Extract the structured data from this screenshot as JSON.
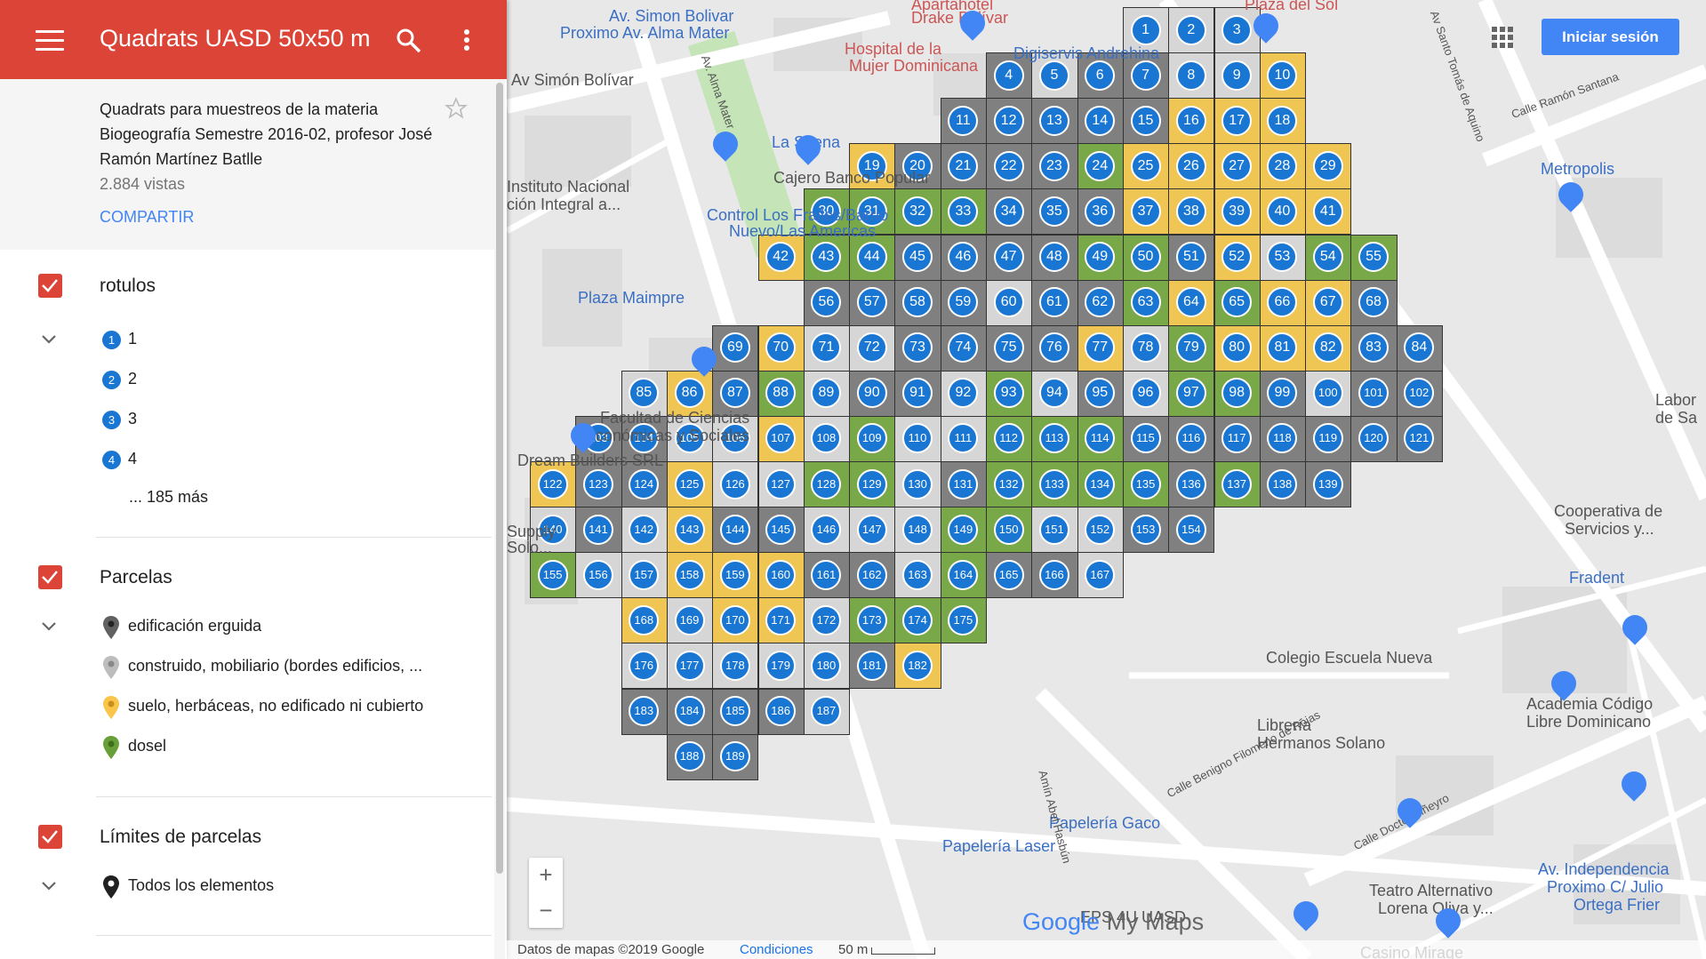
{
  "header": {
    "title": "Quadrats UASD 50x50 m",
    "menu_icon": "hamburger-icon",
    "search_icon": "search-icon",
    "more_icon": "more-vertical-icon"
  },
  "description": {
    "text": "Quadrats para muestreos de la materia Biogeografía Semestre 2016-02, profesor José Ramón Martínez Batlle",
    "views": "2.884 vistas",
    "share": "COMPARTIR"
  },
  "layers": [
    {
      "title": "rotulos",
      "items": [
        "1",
        "2",
        "3",
        "4"
      ],
      "more": "... 185 más"
    },
    {
      "title": "Parcelas",
      "items": [
        {
          "label": "edificación erguida",
          "color": "#616161"
        },
        {
          "label": "construido, mobiliario (bordes edificios, ...",
          "color": "#bdbdbd"
        },
        {
          "label": "suelo, herbáceas, no edificado ni cubierto",
          "color": "#f9c54a"
        },
        {
          "label": "dosel",
          "color": "#689f38"
        }
      ]
    },
    {
      "title": "Límites de parcelas",
      "items": [
        {
          "label": "Todos los elementos",
          "color": "#212121"
        }
      ]
    }
  ],
  "map": {
    "signin": "Iniciar sesión",
    "zoom_in": "+",
    "zoom_out": "−",
    "logo_google": "Google",
    "logo_mymaps": "My Maps",
    "footer": {
      "data": "Datos de mapas ©2019 Google",
      "terms": "Condiciones",
      "scale": "50 m"
    },
    "places": [
      "Av. Simon Bolivar",
      "Proximo Av. Alma Mater",
      "Av Simón Bolívar",
      "Hospital de la",
      "Mujer Dominicana",
      "Apartahotel",
      "Drake Bolívar",
      "Digiservis Andrehina",
      "La Sirena",
      "Cajero Banco Popular",
      "Instituto Nacional",
      "ción Integral a...",
      "Control Los Frailes/Barrio",
      "Nuevo/Las Americas",
      "Plaza Maimpre",
      "Facultad de Ciencias",
      "Económicas y Sociales",
      "Dream Builders SRL",
      "Supply",
      "Solo...",
      "Metropolis",
      "Labor",
      "de Sa",
      "Cooperativa de",
      "Servicios y...",
      "Fradent",
      "Colegio Escuela Nueva",
      "Academia Código",
      "Libre Dominicano",
      "Librería",
      "Hermanos Solano",
      "Papelería Gaco",
      "Papelería Laser",
      "Teatro Alternativo",
      "Lorena Oliva y...",
      "Av. Independencia",
      "Proximo C/ Julio",
      "Ortega Frier",
      "Casino Mirage",
      "EPS 4U UASD",
      "Calle Ramón Santana",
      "Av Santo Tomás de Aquino",
      "Av. Alma Mater",
      "Amín Abel Hasbún",
      "Calle Benigno Filomeno de Rojas",
      "Calle Doctor Piñeyro",
      "Plaza del Sol"
    ]
  },
  "colors": {
    "header_red": "#db4437",
    "link_blue": "#4285f4",
    "label_blue": "#1976d2",
    "dark_cell": "#808080",
    "light_cell": "#d6d6d6",
    "yellow_cell": "#efc653",
    "green_cell": "#79a849"
  },
  "quadrats": {
    "rows": [
      {
        "n": [
          1,
          2,
          3
        ]
      },
      {
        "n": [
          4,
          5,
          6,
          7,
          8,
          9,
          10
        ],
        "t": [
          "d",
          "l",
          "d",
          "d",
          "l",
          "l",
          "y"
        ]
      },
      {
        "n": [
          11,
          12,
          13,
          14,
          15,
          16,
          17,
          18
        ],
        "t": [
          "d",
          "d",
          "d",
          "d",
          "d",
          "y",
          "y",
          "y"
        ]
      },
      {
        "n": [
          19,
          20,
          21,
          22,
          23,
          24,
          25,
          26,
          27,
          28,
          29
        ],
        "t": [
          "y",
          "d",
          "d",
          "d",
          "d",
          "g",
          "y",
          "y",
          "y",
          "y",
          "y"
        ]
      },
      {
        "n": [
          30,
          31,
          32,
          33,
          34,
          35,
          36,
          37,
          38,
          39,
          40,
          41
        ],
        "t": [
          "g",
          "g",
          "g",
          "g",
          "d",
          "d",
          "d",
          "y",
          "y",
          "y",
          "y",
          "y"
        ]
      },
      {
        "n": [
          42,
          43,
          44,
          45,
          46,
          47,
          48,
          49,
          50,
          51,
          52,
          53,
          54,
          55
        ],
        "t": [
          "y",
          "g",
          "g",
          "d",
          "d",
          "d",
          "d",
          "g",
          "g",
          "d",
          "y",
          "l",
          "g",
          "g"
        ]
      },
      {
        "n": [
          56,
          57,
          58,
          59,
          60,
          61,
          62,
          63,
          64,
          65,
          66,
          67,
          68
        ],
        "t": [
          "d",
          "d",
          "d",
          "d",
          "l",
          "d",
          "d",
          "g",
          "y",
          "g",
          "y",
          "y",
          "d"
        ]
      },
      {
        "n": [
          69,
          70,
          71,
          72,
          73,
          74,
          75,
          76,
          77,
          78,
          79,
          80,
          81,
          82,
          83,
          84
        ],
        "t": [
          "d",
          "y",
          "l",
          "l",
          "d",
          "d",
          "d",
          "d",
          "y",
          "l",
          "g",
          "y",
          "y",
          "y",
          "d",
          "d"
        ]
      },
      {
        "n": [
          85,
          86,
          87,
          88,
          89,
          90,
          91,
          92,
          93,
          94,
          95,
          96,
          97,
          98,
          99,
          100,
          101,
          102
        ],
        "t": [
          "l",
          "y",
          "d",
          "g",
          "l",
          "d",
          "d",
          "l",
          "g",
          "l",
          "d",
          "l",
          "g",
          "g",
          "d",
          "l",
          "d",
          "d"
        ]
      },
      {
        "n": [
          103,
          104,
          105,
          106,
          107,
          108,
          109,
          110,
          111,
          112,
          113,
          114,
          115,
          116,
          117,
          118,
          119,
          120,
          121
        ],
        "t": [
          "d",
          "d",
          "l",
          "l",
          "y",
          "l",
          "g",
          "l",
          "l",
          "g",
          "g",
          "g",
          "d",
          "d",
          "d",
          "d",
          "d",
          "d",
          "d"
        ]
      },
      {
        "n": [
          122,
          123,
          124,
          125,
          126,
          127,
          128,
          129,
          130,
          131,
          132,
          133,
          134,
          135,
          136,
          137,
          138,
          139
        ],
        "t": [
          "y",
          "d",
          "d",
          "y",
          "l",
          "l",
          "g",
          "g",
          "l",
          "d",
          "g",
          "g",
          "g",
          "g",
          "d",
          "g",
          "d",
          "d"
        ]
      },
      {
        "n": [
          140,
          141,
          142,
          143,
          144,
          145,
          146,
          147,
          148,
          149,
          150,
          151,
          152,
          153,
          154
        ],
        "t": [
          "l",
          "d",
          "l",
          "y",
          "d",
          "d",
          "l",
          "l",
          "l",
          "g",
          "g",
          "l",
          "l",
          "d",
          "d"
        ]
      },
      {
        "n": [
          155,
          156,
          157,
          158,
          159,
          160,
          161,
          162,
          163,
          164,
          165,
          166,
          167
        ],
        "t": [
          "g",
          "l",
          "l",
          "y",
          "y",
          "y",
          "d",
          "d",
          "l",
          "g",
          "d",
          "d",
          "l"
        ]
      },
      {
        "n": [
          168,
          169,
          170,
          171,
          172,
          173,
          174,
          175
        ],
        "t": [
          "y",
          "l",
          "y",
          "y",
          "l",
          "g",
          "g",
          "g"
        ]
      },
      {
        "n": [
          176,
          177,
          178,
          179,
          180,
          181,
          182
        ],
        "t": [
          "l",
          "l",
          "l",
          "l",
          "l",
          "d",
          "y"
        ]
      },
      {
        "n": [
          183,
          184,
          185,
          186,
          187
        ],
        "t": [
          "d",
          "d",
          "d",
          "d",
          "l"
        ]
      },
      {
        "n": [
          188,
          189
        ],
        "t": [
          "d",
          "d"
        ]
      }
    ]
  }
}
